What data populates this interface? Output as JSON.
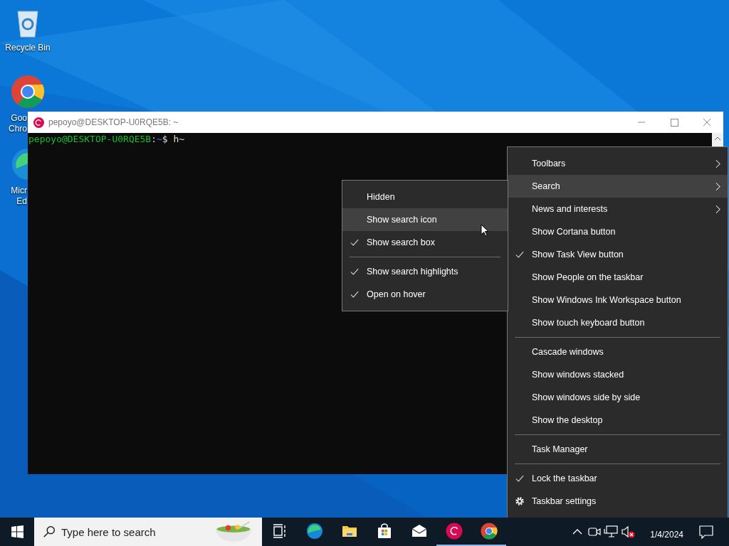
{
  "desktop_icons": [
    {
      "kind": "recycle",
      "label_lines": [
        "Recycle Bin"
      ]
    },
    {
      "kind": "chrome",
      "label_lines": [
        "Goo",
        "Chro"
      ]
    },
    {
      "kind": "edge",
      "label_lines": [
        "Micr",
        "Ed"
      ]
    }
  ],
  "terminal": {
    "title": "pepoyo@DESKTOP-U0RQE5B: ~",
    "prompt": {
      "user_host": "pepoyo@DESKTOP-U0RQE5B",
      "colon": ":",
      "path": "~",
      "symbol": "$",
      "input": "h~"
    }
  },
  "context_menu": {
    "items": [
      {
        "kind": "submenu",
        "label": "Toolbars",
        "checked": false,
        "selected": false
      },
      {
        "kind": "submenu",
        "label": "Search",
        "checked": false,
        "selected": true
      },
      {
        "kind": "submenu",
        "label": "News and interests",
        "checked": false,
        "selected": false
      },
      {
        "kind": "item",
        "label": "Show Cortana button",
        "checked": false,
        "selected": false
      },
      {
        "kind": "item",
        "label": "Show Task View button",
        "checked": true,
        "selected": false
      },
      {
        "kind": "item",
        "label": "Show People on the taskbar",
        "checked": false,
        "selected": false
      },
      {
        "kind": "item",
        "label": "Show Windows Ink Workspace button",
        "checked": false,
        "selected": false
      },
      {
        "kind": "item",
        "label": "Show touch keyboard button",
        "checked": false,
        "selected": false
      },
      {
        "kind": "separator"
      },
      {
        "kind": "item",
        "label": "Cascade windows",
        "checked": false,
        "selected": false
      },
      {
        "kind": "item",
        "label": "Show windows stacked",
        "checked": false,
        "selected": false
      },
      {
        "kind": "item",
        "label": "Show windows side by side",
        "checked": false,
        "selected": false
      },
      {
        "kind": "item",
        "label": "Show the desktop",
        "checked": false,
        "selected": false
      },
      {
        "kind": "separator"
      },
      {
        "kind": "item",
        "label": "Task Manager",
        "checked": false,
        "selected": false
      },
      {
        "kind": "separator"
      },
      {
        "kind": "item",
        "label": "Lock the taskbar",
        "checked": true,
        "selected": false
      },
      {
        "kind": "settings",
        "label": "Taskbar settings",
        "selected": false
      }
    ]
  },
  "search_submenu": {
    "items": [
      {
        "kind": "item",
        "label": "Hidden",
        "checked": false,
        "selected": false
      },
      {
        "kind": "item",
        "label": "Show search icon",
        "checked": false,
        "selected": true
      },
      {
        "kind": "item",
        "label": "Show search box",
        "checked": true,
        "selected": false
      },
      {
        "kind": "separator"
      },
      {
        "kind": "item",
        "label": "Show search highlights",
        "checked": true,
        "selected": false
      },
      {
        "kind": "item",
        "label": "Open on hover",
        "checked": true,
        "selected": false
      }
    ]
  },
  "taskbar": {
    "search": {
      "placeholder": "Type here to search"
    },
    "apps": [
      {
        "kind": "taskview",
        "running": false
      },
      {
        "kind": "edge",
        "running": false
      },
      {
        "kind": "explorer",
        "running": false
      },
      {
        "kind": "store",
        "running": false
      },
      {
        "kind": "mail",
        "running": false
      },
      {
        "kind": "debian",
        "running": true
      },
      {
        "kind": "chrome",
        "running": true
      }
    ],
    "date": "1/4/2024"
  }
}
